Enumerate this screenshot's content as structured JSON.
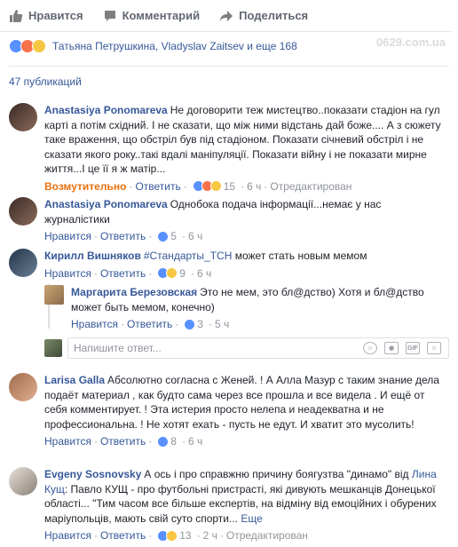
{
  "actions": {
    "like": "Нравится",
    "comment": "Комментарий",
    "share": "Поделиться"
  },
  "reactions": {
    "text": "Татьяна Петрушкина, Vladyslav Zaitsev и еще 168"
  },
  "watermark": "0629.com.ua",
  "pub_count": "47 публикаций",
  "comments": [
    {
      "author": "Anastasiya Ponomareva",
      "text": "Не договорити теж мистецтво..показати стадіон на гул карті а потім східний. І не сказати, що між ними відстань дай боже.... А з сюжету таке враження, що обстріл був під стадіоном. Показати січневий обстріл і не сказати якого року..такі вдалі маніпуляції. Показати війну і не показати мирне життя...І це її я ж матір...",
      "reaction_label": "Возмутительно",
      "reply": "Ответить",
      "count": "15",
      "time": "6 ч",
      "edited": "Отредактирован"
    },
    {
      "author": "Anastasiya Ponomareva",
      "text": "Однобока подача інформації...немає у нас журналістики",
      "like": "Нравится",
      "reply": "Ответить",
      "count": "5",
      "time": "6 ч"
    },
    {
      "author": "Кирилл Вишняков",
      "hashtag": "#Стандарты_ТСН",
      "text": " может стать новым мемом",
      "like": "Нравится",
      "reply": "Ответить",
      "count": "9",
      "time": "6 ч"
    },
    {
      "author": "Маргарита Березовская",
      "text": "Это не мем, это бл@дство) Хотя и бл@дство может быть мемом, конечно)",
      "like": "Нравится",
      "reply": "Ответить",
      "count": "3",
      "time": "5 ч"
    },
    {
      "author": "Larisa Galla",
      "text": "Абсолютно согласна с Женей. ! А Алла Мазур с таким знание дела подаёт материал , как будто сама через все прошла и все видела . И ещё от себя комментирует. ! Эта истерия просто нелепа и неадекватна и не профессиональна. ! Не хотят ехать - пусть не едут. И хватит это мусолить!",
      "like": "Нравится",
      "reply": "Ответить",
      "count": "8",
      "time": "6 ч"
    },
    {
      "author": "Evgeny Sosnovsky",
      "text_a": "А ось і про справжню причину боягузтва \"динамо\" від ",
      "mention": "Лина Кущ",
      "text_b": ": Павло КУЩ - про футбольні пристрасті, які дивують мешканців Донецької області... \"Тим часом все більше експертів, на відміну від емоційних і обурених маріупольців, мають свій суто спорти...",
      "more": "Еще",
      "like": "Нравится",
      "reply": "Ответить",
      "count": "13",
      "time": "2 ч",
      "edited": "Отредактирован"
    }
  ],
  "reply_placeholder": "Напишите ответ...",
  "reply_tools": {
    "gif": "GIF"
  }
}
